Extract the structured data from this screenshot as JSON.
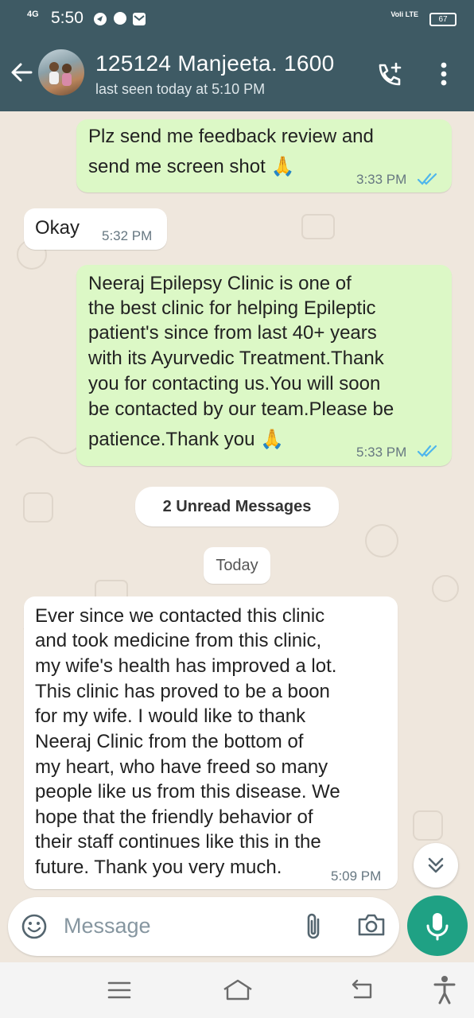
{
  "status_bar": {
    "time": "5:50",
    "network": "4G",
    "volte": "Voli LTE",
    "battery": "67"
  },
  "header": {
    "contact_name": "125124 Manjeeta. 1600",
    "last_seen": "last seen today at 5:10 PM"
  },
  "messages": [
    {
      "direction": "outgoing",
      "lines": [
        "Plz send me feedback review and",
        "send me screen shot 🙏"
      ],
      "time": "3:33 PM",
      "status": "read"
    },
    {
      "direction": "incoming",
      "lines": [
        "Okay"
      ],
      "time": "5:32 PM"
    },
    {
      "direction": "outgoing",
      "lines": [
        "Neeraj Epilepsy Clinic is one of",
        "the best clinic for helping Epileptic",
        "patient's since from last 40+ years",
        "with its Ayurvedic Treatment.Thank",
        "you for contacting us.You will soon",
        "be contacted by our team.Please be",
        "patience.Thank you 🙏"
      ],
      "time": "5:33 PM",
      "status": "read"
    },
    {
      "direction": "incoming",
      "lines": [
        "Ever since we contacted this clinic",
        "and took medicine from this clinic,",
        "my wife's health has improved a lot.",
        "This clinic has proved to be a boon",
        "for my wife. I would like to thank",
        "Neeraj Clinic from the bottom of",
        "my heart, who have freed so many",
        "people like us from this disease. We",
        "hope that the friendly behavior of",
        "their staff continues like this in the",
        "future. Thank you very much."
      ],
      "time": "5:09 PM"
    }
  ],
  "dividers": {
    "unread": "2 Unread Messages",
    "date": "Today"
  },
  "input": {
    "placeholder": "Message"
  },
  "icons": {
    "back": "arrow-left-icon",
    "call": "add-call-icon",
    "menu": "more-vert-icon",
    "emoji": "emoji-icon",
    "attach": "paperclip-icon",
    "camera": "camera-icon",
    "mic": "mic-icon",
    "scroll": "double-chevron-down-icon"
  },
  "colors": {
    "header": "#3e5a64",
    "outgoing_bubble": "#dcf8c6",
    "incoming_bubble": "#ffffff",
    "read_ticks": "#4fb6ec",
    "mic_button": "#1fa184"
  }
}
